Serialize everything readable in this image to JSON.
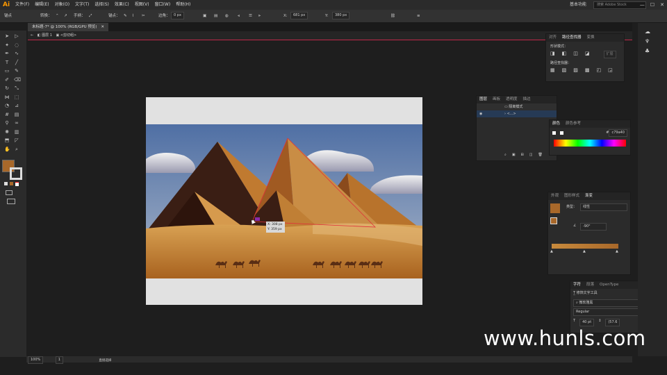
{
  "app": {
    "logo": "Ai"
  },
  "menu": [
    "文件(F)",
    "编辑(E)",
    "对象(O)",
    "文字(T)",
    "选择(S)",
    "效果(C)",
    "视图(V)",
    "窗口(W)",
    "帮助(H)"
  ],
  "menubar_right": {
    "workspace": "基本功能",
    "search_placeholder": "搜索 Adobe Stock"
  },
  "control_bar": {
    "anchor_label": "锚点",
    "convert_label": "转换：",
    "handle_label": "手柄：",
    "anchor2_label": "锚点：",
    "corner_label": "边角：",
    "corner_value": "0 px",
    "x_label": "X:",
    "x_value": "681 px",
    "y_label": "Y:",
    "y_value": "380 px"
  },
  "document_tab": "未标题-7* @ 100% (RGB/GPU 预览)",
  "breadcrumb": {
    "layer": "图层 1",
    "group": "<剪切组>"
  },
  "tooltip": {
    "x": "X: 308 px",
    "y": "Y: 359 px"
  },
  "pathfinder_panel": {
    "tabs": [
      "对齐",
      "路径查找器",
      "变换"
    ],
    "shape_modes": "形状模式：",
    "expand": "扩展",
    "pathfinders": "路径查找器："
  },
  "layers_panel": {
    "tabs": [
      "图层",
      "画板",
      "透明度",
      "描边"
    ],
    "row1": "隔离模式",
    "row2": "<...>"
  },
  "color_panel": {
    "tabs": [
      "颜色",
      "颜色参考"
    ],
    "hex_label": "#",
    "hex": "c79a40"
  },
  "gradient_panel": {
    "tabs": [
      "外观",
      "图形样式",
      "渐变"
    ],
    "type_label": "类型：",
    "type_value": "线性",
    "angle": "-90°"
  },
  "character_panel": {
    "tabs": [
      "字符",
      "段落",
      "OpenType"
    ],
    "touch_tool": "修饰文字工具",
    "font": "微软雅黑",
    "style": "Regular",
    "size": "40 pt",
    "leading": "(57.6"
  },
  "status_bar": {
    "zoom": "100%",
    "page": "1",
    "mode": "直接选择"
  },
  "watermark": "www.hunls.com",
  "colors": {
    "fill": "#a8682a",
    "accent_line": "#c0284a",
    "sky_top": "#5a78a8",
    "sand": "#c88a3c"
  }
}
